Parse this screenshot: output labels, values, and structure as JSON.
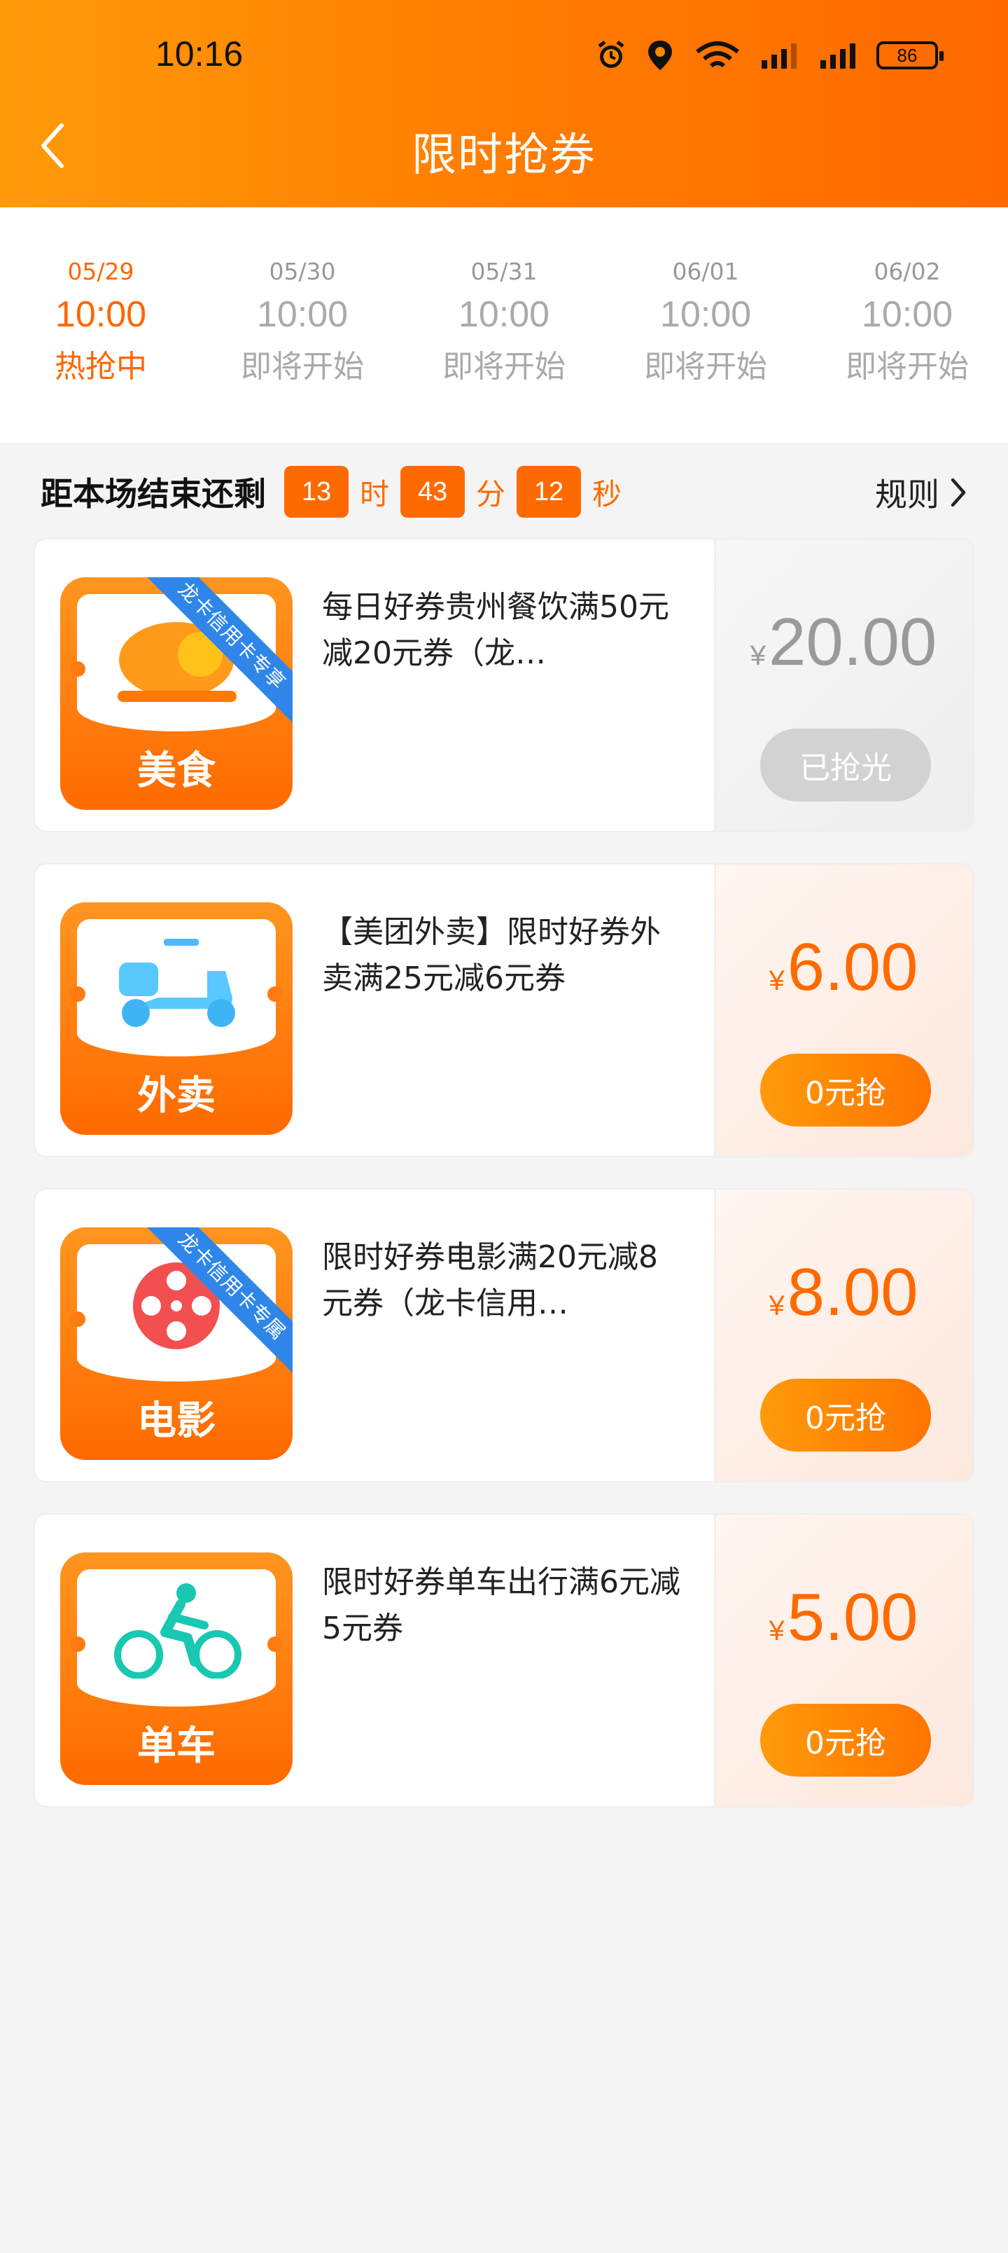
{
  "status_bar": {
    "time": "10:16",
    "battery": "86"
  },
  "header": {
    "title": "限时抢券"
  },
  "tabs": [
    {
      "date": "05/29",
      "time": "10:00",
      "status": "热抢中"
    },
    {
      "date": "05/30",
      "time": "10:00",
      "status": "即将开始"
    },
    {
      "date": "05/31",
      "time": "10:00",
      "status": "即将开始"
    },
    {
      "date": "06/01",
      "time": "10:00",
      "status": "即将开始"
    },
    {
      "date": "06/02",
      "time": "10:00",
      "status": "即将开始"
    }
  ],
  "countdown": {
    "label": "距本场结束还剩",
    "hours": "13",
    "hours_unit": "时",
    "minutes": "43",
    "minutes_unit": "分",
    "seconds": "12",
    "seconds_unit": "秒",
    "rules": "规则"
  },
  "coupons": [
    {
      "category": "美食",
      "ribbon": "龙卡信用卡专享",
      "title": "每日好券贵州餐饮满50元减20元券（龙…",
      "currency": "¥",
      "price": "20.00",
      "button": "已抢光"
    },
    {
      "category": "外卖",
      "ribbon": "",
      "title": "【美团外卖】限时好券外卖满25元减6元券",
      "currency": "¥",
      "price": "6.00",
      "button": "0元抢"
    },
    {
      "category": "电影",
      "ribbon": "龙卡信用卡专属",
      "title": "限时好券电影满20元减8元券（龙卡信用…",
      "currency": "¥",
      "price": "8.00",
      "button": "0元抢"
    },
    {
      "category": "单车",
      "ribbon": "",
      "title": "限时好券单车出行满6元减5元券",
      "currency": "¥",
      "price": "5.00",
      "button": "0元抢"
    }
  ],
  "colors": {
    "accent": "#ff6a00",
    "ribbon": "#2f86e8"
  }
}
